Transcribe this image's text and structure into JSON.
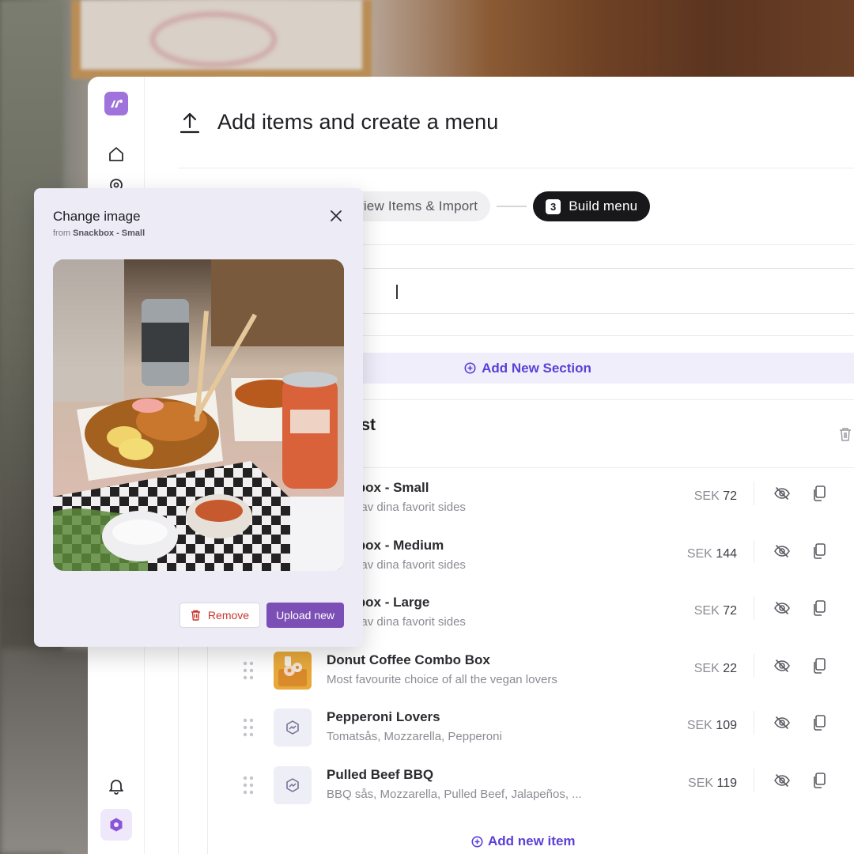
{
  "header": {
    "title": "Add items and create a menu",
    "icon": "upload-icon"
  },
  "stepper": {
    "steps": [
      {
        "label": "Review Items & Import",
        "status": "done"
      },
      {
        "number": "3",
        "label": "Build menu",
        "status": "current"
      }
    ]
  },
  "menu": {
    "add_section_label": "Add New Section",
    "section": {
      "title": "sy Crust"
    },
    "add_item_label": "Add new item",
    "items": [
      {
        "name": "nackbox - Small",
        "description": "älj två av dina favorit sides",
        "currency": "SEK",
        "price": "72",
        "thumb": "none"
      },
      {
        "name": "nackbox - Medium",
        "description": "älj två av dina favorit sides",
        "currency": "SEK",
        "price": "144",
        "thumb": "none"
      },
      {
        "name": "nackbox - Large",
        "description": "älj två av dina favorit sides",
        "currency": "SEK",
        "price": "72",
        "thumb": "none"
      },
      {
        "name": "Donut Coffee Combo Box",
        "description": "Most favourite choice of all the vegan lovers",
        "currency": "SEK",
        "price": "22",
        "thumb": "photo"
      },
      {
        "name": "Pepperoni Lovers",
        "description": "Tomatsås, Mozzarella, Pepperoni",
        "currency": "SEK",
        "price": "109",
        "thumb": "placeholder-image-icon"
      },
      {
        "name": "Pulled Beef BBQ",
        "description": "BBQ sås, Mozzarella, Pulled Beef, Jalapeños, ...",
        "currency": "SEK",
        "price": "119",
        "thumb": "placeholder-image-icon"
      }
    ]
  },
  "modal": {
    "title": "Change image",
    "subtitle_prefix": "from",
    "subtitle_source": "Snackbox - Small",
    "remove_label": "Remove",
    "upload_label": "Upload new"
  },
  "colors": {
    "accent": "#5b3fd6",
    "brand": "#9f73db",
    "primary_button": "#7b4fb5",
    "danger": "#c9362e"
  }
}
